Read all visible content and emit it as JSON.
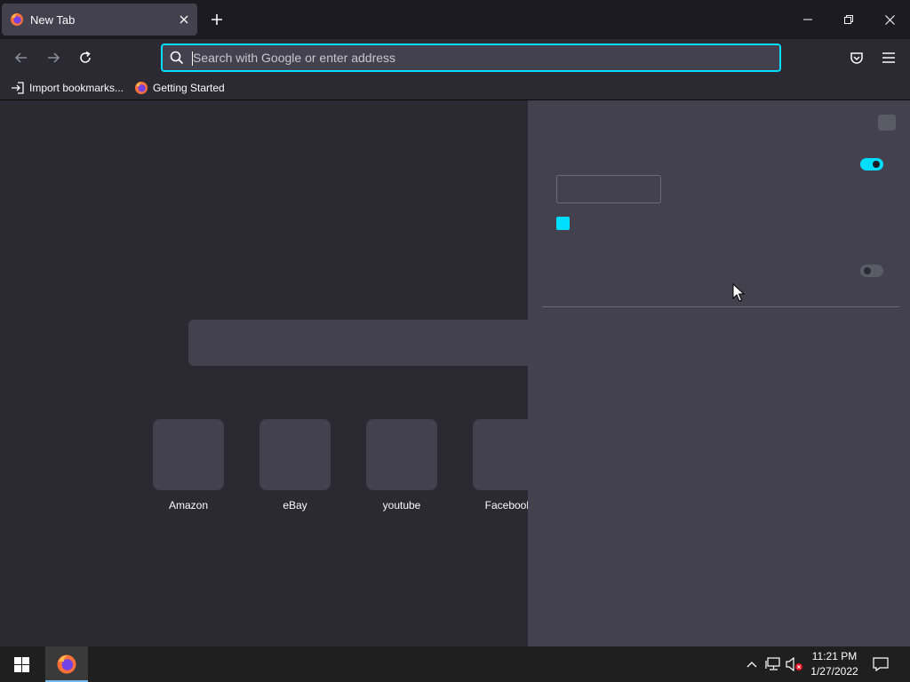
{
  "tab": {
    "title": "New Tab"
  },
  "urlbar": {
    "placeholder": "Search with Google or enter address"
  },
  "bookmarks": [
    {
      "label": "Import bookmarks..."
    },
    {
      "label": "Getting Started"
    }
  ],
  "top_sites": [
    {
      "label": "Amazon"
    },
    {
      "label": "eBay"
    },
    {
      "label": "youtube"
    },
    {
      "label": "Facebook"
    }
  ],
  "customize_panel": {
    "toggle_1_state": "on",
    "toggle_2_state": "off",
    "checkbox_checked": true
  },
  "taskbar": {
    "time": "11:21 PM",
    "date": "1/27/2022"
  },
  "colors": {
    "accent": "#00ddff",
    "toolbar": "#2b2a33",
    "tabstrip": "#1c1b22",
    "panel": "#42414d"
  }
}
